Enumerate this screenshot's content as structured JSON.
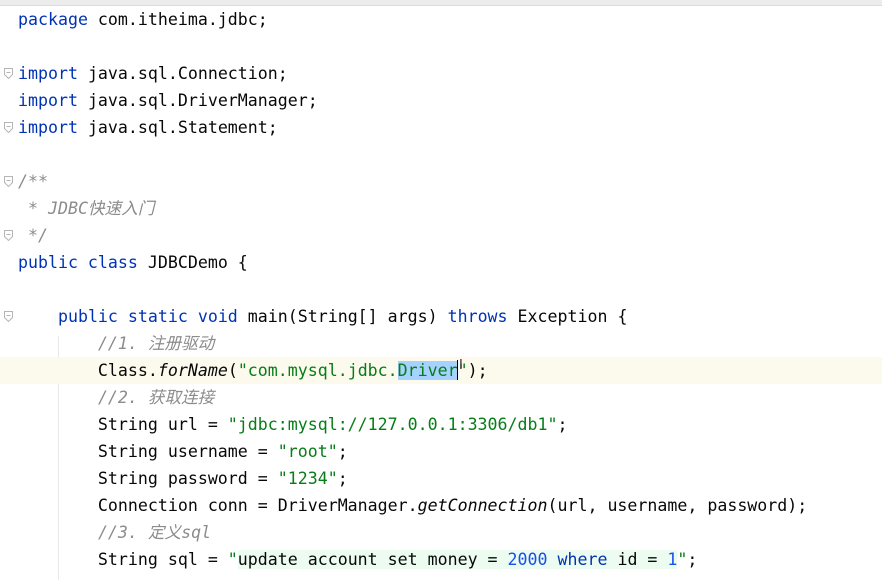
{
  "editor": {
    "lines": [
      {
        "id": "l1",
        "tokens": [
          [
            "kw",
            "package"
          ],
          [
            "plain",
            " com.itheima.jdbc;"
          ]
        ]
      },
      {
        "id": "l2",
        "tokens": []
      },
      {
        "id": "l3",
        "tokens": [
          [
            "kw",
            "import"
          ],
          [
            "plain",
            " java.sql.Connection;"
          ]
        ]
      },
      {
        "id": "l4",
        "tokens": [
          [
            "kw",
            "import"
          ],
          [
            "plain",
            " java.sql.DriverManager;"
          ]
        ]
      },
      {
        "id": "l5",
        "tokens": [
          [
            "kw",
            "import"
          ],
          [
            "plain",
            " java.sql.Statement;"
          ]
        ]
      },
      {
        "id": "l6",
        "tokens": []
      },
      {
        "id": "l7",
        "tokens": [
          [
            "cmt",
            "/**"
          ]
        ]
      },
      {
        "id": "l8",
        "tokens": [
          [
            "cmt",
            " * JDBC快速入门"
          ]
        ]
      },
      {
        "id": "l9",
        "tokens": [
          [
            "cmt",
            " */"
          ]
        ]
      },
      {
        "id": "l10",
        "tokens": [
          [
            "kw",
            "public class"
          ],
          [
            "plain",
            " JDBCDemo {"
          ]
        ]
      },
      {
        "id": "l11",
        "tokens": []
      },
      {
        "id": "l12",
        "tokens": [
          [
            "plain",
            "    "
          ],
          [
            "kw",
            "public static void"
          ],
          [
            "plain",
            " main(String[] args) "
          ],
          [
            "kw",
            "throws"
          ],
          [
            "plain",
            " Exception {"
          ]
        ]
      },
      {
        "id": "l13",
        "tokens": [
          [
            "plain",
            "        "
          ],
          [
            "cmt",
            "//1. 注册驱动"
          ]
        ]
      },
      {
        "id": "l14",
        "tokens": [
          [
            "plain",
            "        Class."
          ],
          [
            "mth",
            "forName"
          ],
          [
            "plain",
            "("
          ],
          [
            "str",
            "\"com.mysql.jdbc."
          ],
          [
            "sel",
            "Driver"
          ],
          [
            "caret",
            ""
          ],
          [
            "str",
            "\""
          ],
          [
            "plain",
            ");"
          ]
        ]
      },
      {
        "id": "l15",
        "tokens": [
          [
            "plain",
            "        "
          ],
          [
            "cmt",
            "//2. 获取连接"
          ]
        ]
      },
      {
        "id": "l16",
        "tokens": [
          [
            "plain",
            "        String url = "
          ],
          [
            "str",
            "\"jdbc:mysql://127.0.0.1:3306/db1\""
          ],
          [
            "plain",
            ";"
          ]
        ]
      },
      {
        "id": "l17",
        "tokens": [
          [
            "plain",
            "        String username = "
          ],
          [
            "str",
            "\"root\""
          ],
          [
            "plain",
            ";"
          ]
        ]
      },
      {
        "id": "l18",
        "tokens": [
          [
            "plain",
            "        String password = "
          ],
          [
            "str",
            "\"1234\""
          ],
          [
            "plain",
            ";"
          ]
        ]
      },
      {
        "id": "l19",
        "tokens": [
          [
            "plain",
            "        Connection conn = DriverManager."
          ],
          [
            "mth",
            "getConnection"
          ],
          [
            "plain",
            "(url, username, password);"
          ]
        ]
      },
      {
        "id": "l20",
        "tokens": [
          [
            "plain",
            "        "
          ],
          [
            "cmt",
            "//3. 定义sql"
          ]
        ]
      },
      {
        "id": "l21",
        "tokens": [
          [
            "plain",
            "        String sql = "
          ],
          [
            "str",
            "\""
          ],
          [
            "inj-plain",
            "update account set money = "
          ],
          [
            "inj-num",
            "2000"
          ],
          [
            "inj-kw",
            " where"
          ],
          [
            "inj-plain",
            " id = "
          ],
          [
            "inj-num",
            "1"
          ],
          [
            "str",
            "\""
          ],
          [
            "plain",
            ";"
          ]
        ]
      }
    ],
    "current_line": 14,
    "fold_lines": [
      3,
      5,
      7,
      9,
      12
    ]
  }
}
